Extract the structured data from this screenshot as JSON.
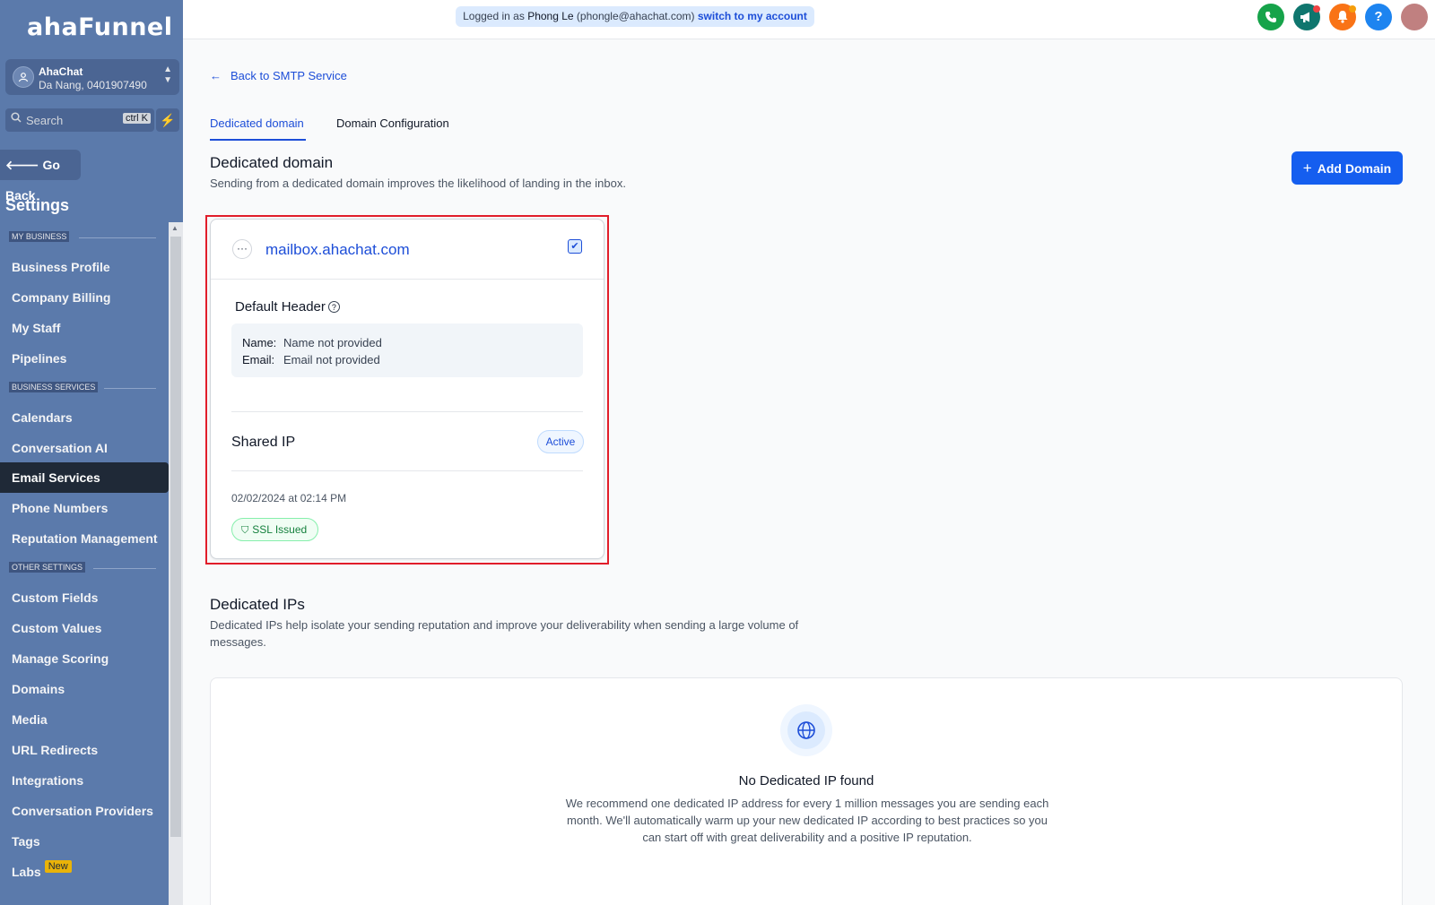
{
  "sidebar": {
    "logo": "ahaFunnel",
    "account": {
      "name": "AhaChat",
      "location": "Da Nang, 0401907490"
    },
    "search": {
      "placeholder": "Search",
      "shortcut": "ctrl K"
    },
    "go_back": "Go Back",
    "title": "Settings",
    "sections": [
      {
        "label": "MY BUSINESS",
        "items": [
          "Business Profile",
          "Company Billing",
          "My Staff",
          "Pipelines"
        ]
      },
      {
        "label": "BUSINESS SERVICES",
        "items": [
          "Calendars",
          "Conversation AI",
          "Email Services",
          "Phone Numbers",
          "Reputation Management"
        ]
      },
      {
        "label": "OTHER SETTINGS",
        "items": [
          "Custom Fields",
          "Custom Values",
          "Manage Scoring",
          "Domains",
          "Media",
          "URL Redirects",
          "Integrations",
          "Conversation Providers",
          "Tags",
          "Labs"
        ]
      }
    ],
    "active_item": "Email Services",
    "labs_badge": "New"
  },
  "topbar": {
    "logged_in_prefix": "Logged in as",
    "user_name": "Phong Le",
    "user_email": "(phongle@ahachat.com)",
    "switch_link": "switch to my account",
    "help_glyph": "?",
    "colors": {
      "phone": "#16a34a",
      "announce": "#0f766e",
      "bell": "#f97316",
      "help": "#1d84f0"
    }
  },
  "main": {
    "back_link": "Back to SMTP Service",
    "tabs": [
      {
        "label": "Dedicated domain",
        "active": true
      },
      {
        "label": "Domain Configuration",
        "active": false
      }
    ],
    "dedicated_domain": {
      "title": "Dedicated domain",
      "subtitle": "Sending from a dedicated domain improves the likelihood of landing in the inbox.",
      "add_button": "Add Domain"
    },
    "domain_card": {
      "domain": "mailbox.ahachat.com",
      "selected": true,
      "default_header_label": "Default Header",
      "name_key": "Name:",
      "name_value": "Name not provided",
      "email_key": "Email:",
      "email_value": "Email not provided",
      "ip_type": "Shared IP",
      "status": "Active",
      "created": "02/02/2024 at 02:14 PM",
      "ssl": "SSL Issued"
    },
    "dedicated_ips": {
      "title": "Dedicated IPs",
      "subtitle": "Dedicated IPs help isolate your sending reputation and improve your deliverability when sending a large volume of messages.",
      "empty_title": "No Dedicated IP found",
      "empty_desc": "We recommend one dedicated IP address for every 1 million messages you are sending each month. We'll automatically warm up your new dedicated IP according to best practices so you can start off with great deliverability and a positive IP reputation."
    }
  }
}
